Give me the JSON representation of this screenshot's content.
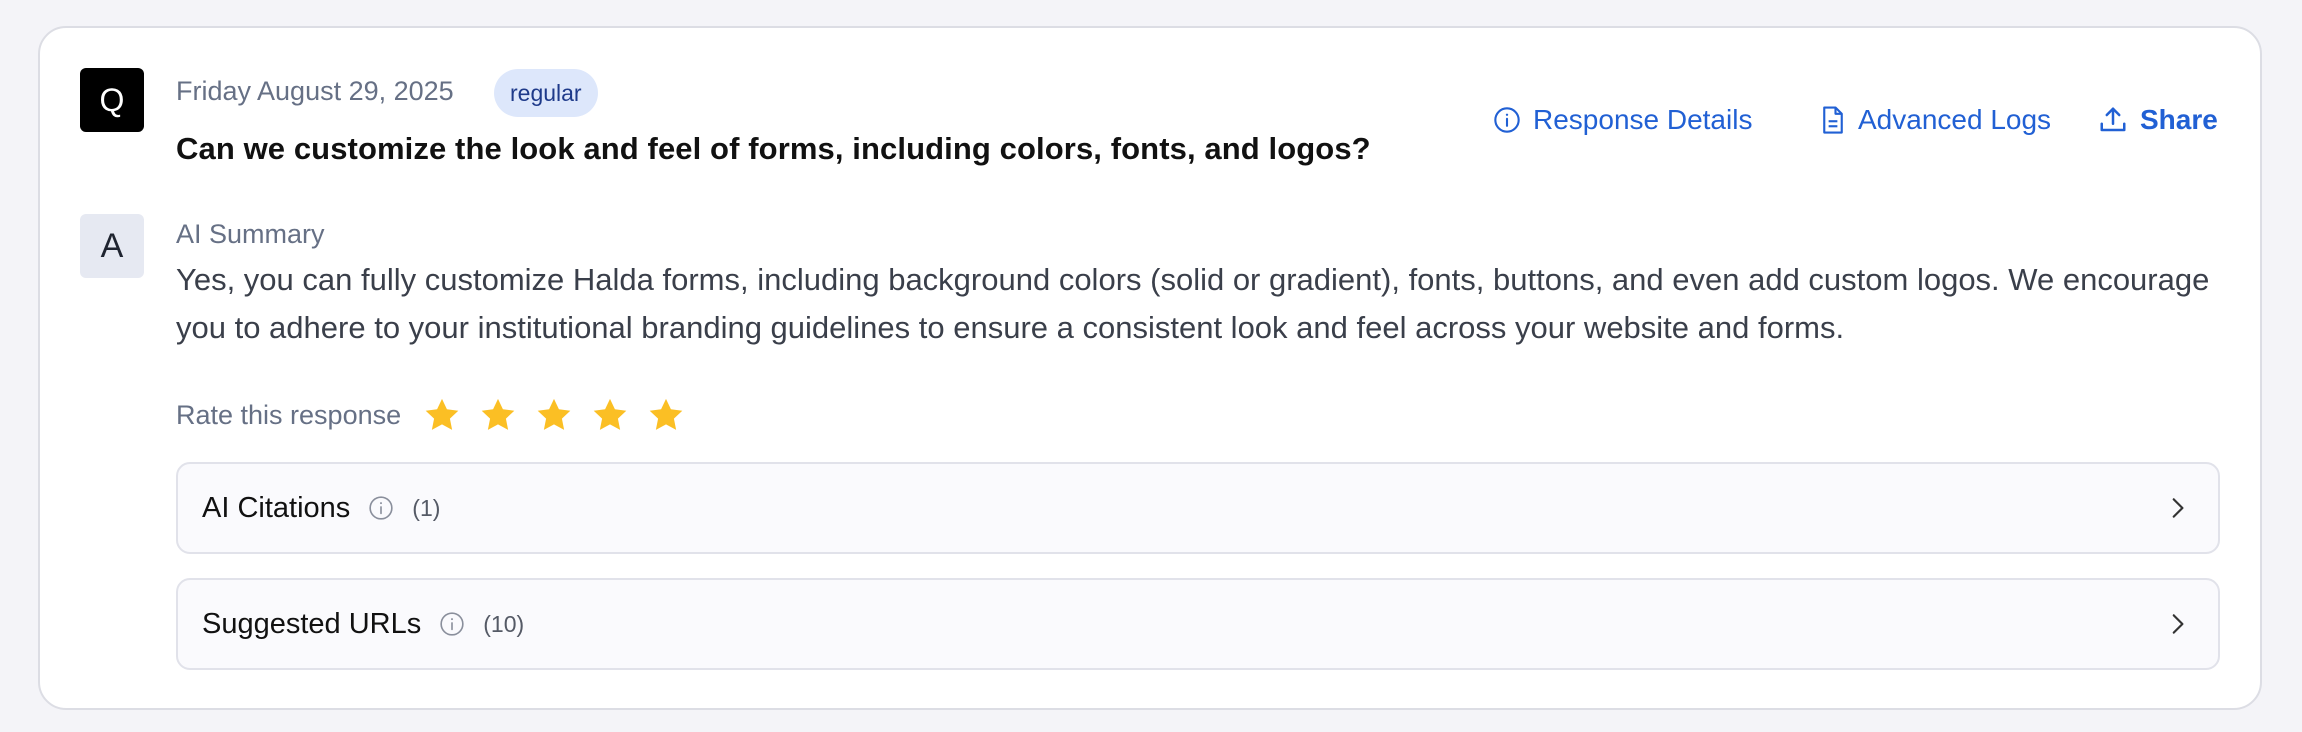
{
  "question": {
    "avatar_letter": "Q",
    "date": "Friday August 29, 2025",
    "badge": "regular",
    "text": "Can we customize the look and feel of forms, including colors, fonts, and logos?"
  },
  "actions": {
    "response_details": "Response Details",
    "advanced_logs": "Advanced Logs",
    "share": "Share"
  },
  "answer": {
    "avatar_letter": "A",
    "label": "AI Summary",
    "text": "Yes, you can fully customize Halda forms, including background colors (solid or gradient), fonts, buttons, and even add custom logos. We encourage you to adhere to your institutional branding guidelines to ensure a consistent look and feel across your website and forms."
  },
  "rating": {
    "label": "Rate this response",
    "stars_total": 5,
    "stars_filled": 5,
    "star_color": "#fbbf24"
  },
  "panels": {
    "citations": {
      "title": "AI Citations",
      "count": "(1)"
    },
    "urls": {
      "title": "Suggested URLs",
      "count": "(10)"
    }
  },
  "colors": {
    "accent": "#2160d4",
    "badge_bg": "#dde7fb",
    "badge_text": "#1e3a8a"
  },
  "icons": {
    "response_details": "info-circle-icon",
    "advanced_logs": "document-icon",
    "share": "upload-share-icon",
    "panel_info": "info-circle-icon",
    "panel_chevron": "chevron-right-icon",
    "star": "star-icon"
  }
}
